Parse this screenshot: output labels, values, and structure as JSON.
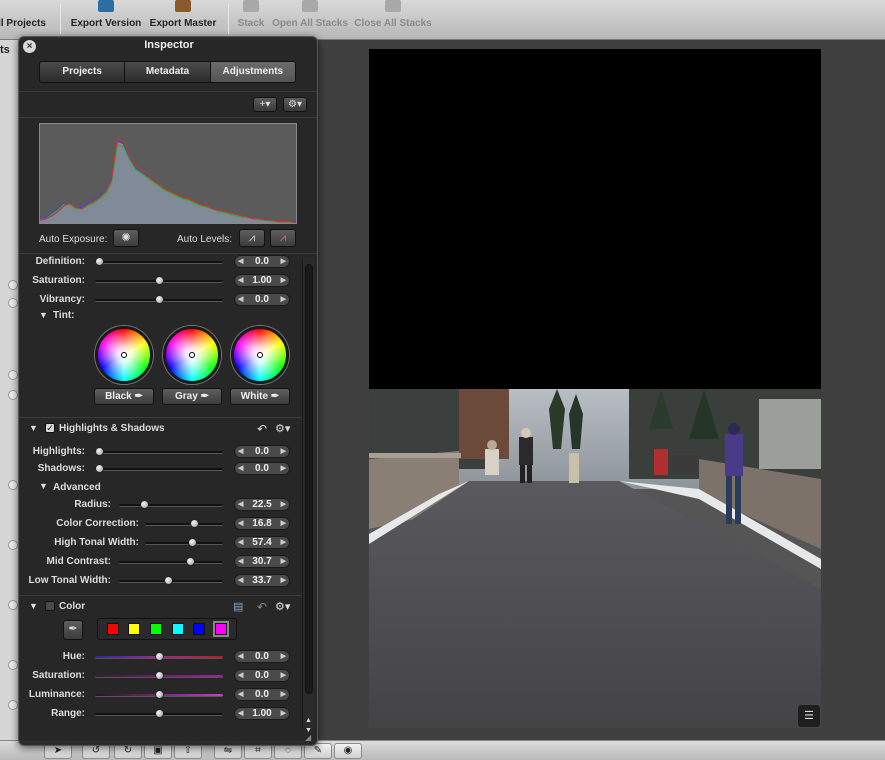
{
  "toolbar": {
    "items": [
      {
        "label": "ll Projects",
        "dim": false
      },
      {
        "label": "Export Version",
        "dim": false
      },
      {
        "label": "Export Master",
        "dim": false
      },
      {
        "label": "Stack",
        "dim": true
      },
      {
        "label": "Open All Stacks",
        "dim": true
      },
      {
        "label": "Close All Stacks",
        "dim": true
      }
    ]
  },
  "leftstrip": {
    "fragment": "ts"
  },
  "inspector": {
    "title": "Inspector",
    "close_icon": "close-icon",
    "tabs": [
      {
        "label": "Projects",
        "active": false
      },
      {
        "label": "Metadata",
        "active": false
      },
      {
        "label": "Adjustments",
        "active": true
      }
    ],
    "add_button": "+",
    "action_button": "gear-icon",
    "auto_exposure_label": "Auto Exposure:",
    "auto_levels_label": "Auto Levels:"
  },
  "enhance": {
    "sliders": [
      {
        "label": "Definition:",
        "value": "0.0",
        "fraction": 0.0
      },
      {
        "label": "Saturation:",
        "value": "1.00",
        "fraction": 0.5
      },
      {
        "label": "Vibrancy:",
        "value": "0.0",
        "fraction": 0.5
      }
    ],
    "tint_label": "Tint:",
    "wheels": [
      {
        "label": "Black"
      },
      {
        "label": "Gray"
      },
      {
        "label": "White"
      }
    ]
  },
  "highlights_shadows": {
    "title": "Highlights & Shadows",
    "enabled": true,
    "sliders": [
      {
        "label": "Highlights:",
        "value": "0.0",
        "fraction": 0.0
      },
      {
        "label": "Shadows:",
        "value": "0.0",
        "fraction": 0.0
      }
    ],
    "advanced_label": "Advanced",
    "advanced_sliders": [
      {
        "label": "Radius:",
        "value": "22.5",
        "fraction": 0.225
      },
      {
        "label": "Color Correction:",
        "value": "16.8",
        "fraction": 0.65
      },
      {
        "label": "High Tonal Width:",
        "value": "57.4",
        "fraction": 0.63
      },
      {
        "label": "Mid Contrast:",
        "value": "30.7",
        "fraction": 0.707
      },
      {
        "label": "Low Tonal Width:",
        "value": "33.7",
        "fraction": 0.47
      }
    ]
  },
  "color": {
    "title": "Color",
    "enabled": false,
    "swatches": [
      "#ff0000",
      "#ffff00",
      "#00ff00",
      "#00ffff",
      "#0000ff",
      "#ff00ff"
    ],
    "selected_swatch": 5,
    "sliders": [
      {
        "label": "Hue:",
        "value": "0.0",
        "fraction": 0.5,
        "track": "linear-gradient(90deg,#2a2aa0,#a02a8a,#b02020)"
      },
      {
        "label": "Saturation:",
        "value": "0.0",
        "fraction": 0.5,
        "track": "linear-gradient(90deg,#3a1a3a,#a020a0)"
      },
      {
        "label": "Luminance:",
        "value": "0.0",
        "fraction": 0.5,
        "track": "linear-gradient(90deg,#2a102a,#c040c0)"
      },
      {
        "label": "Range:",
        "value": "1.00",
        "fraction": 0.5,
        "track": "#111"
      }
    ]
  },
  "histogram": {
    "red": [
      2,
      3,
      5,
      8,
      12,
      14,
      11,
      10,
      13,
      15,
      18,
      22,
      30,
      60,
      58,
      48,
      40,
      37,
      34,
      30,
      27,
      24,
      22,
      20,
      18,
      17,
      15,
      13,
      12,
      10,
      9,
      8,
      7,
      6,
      5,
      4,
      3,
      3,
      2,
      2,
      1,
      1,
      1,
      0
    ],
    "green": [
      2,
      3,
      6,
      9,
      13,
      13,
      10,
      10,
      12,
      14,
      17,
      20,
      28,
      55,
      54,
      45,
      38,
      35,
      32,
      29,
      26,
      23,
      21,
      19,
      17,
      16,
      14,
      12,
      11,
      10,
      8,
      7,
      6,
      5,
      4,
      4,
      3,
      2,
      2,
      1,
      1,
      1,
      0,
      0
    ],
    "blue": [
      3,
      4,
      7,
      10,
      14,
      13,
      11,
      11,
      14,
      16,
      19,
      23,
      31,
      58,
      56,
      46,
      39,
      36,
      33,
      30,
      27,
      24,
      22,
      20,
      18,
      17,
      15,
      13,
      12,
      10,
      9,
      8,
      7,
      6,
      5,
      4,
      3,
      3,
      2,
      2,
      1,
      1,
      1,
      1
    ]
  },
  "bottombar": {
    "tools": [
      "pointer-tool-icon",
      "rotate-left-icon",
      "rotate-right-icon",
      "stamp-icon",
      "lift-icon",
      "straighten-icon",
      "crop-icon",
      "spot-patch-icon",
      "brush-icon",
      "red-eye-icon"
    ]
  }
}
